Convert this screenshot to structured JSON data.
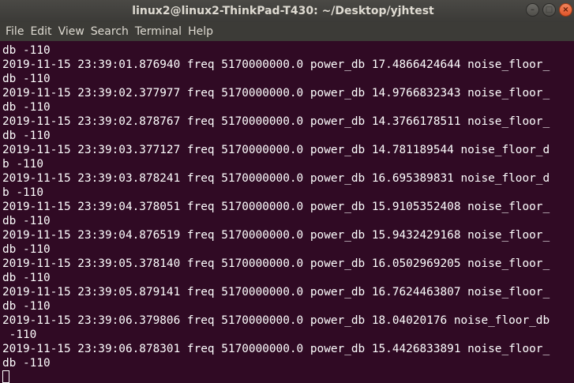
{
  "window": {
    "title": "linux2@linux2-ThinkPad-T430: ~/Desktop/yjhtest",
    "controls": {
      "minimize_glyph": "–",
      "maximize_glyph": "□",
      "close_glyph": "×"
    }
  },
  "menubar": {
    "items": [
      "File",
      "Edit",
      "View",
      "Search",
      "Terminal",
      "Help"
    ]
  },
  "terminal": {
    "lines": [
      "db -110",
      "2019-11-15 23:39:01.876940 freq 5170000000.0 power_db 17.4866424644 noise_floor_",
      "db -110",
      "2019-11-15 23:39:02.377977 freq 5170000000.0 power_db 14.9766832343 noise_floor_",
      "db -110",
      "2019-11-15 23:39:02.878767 freq 5170000000.0 power_db 14.3766178511 noise_floor_",
      "db -110",
      "2019-11-15 23:39:03.377127 freq 5170000000.0 power_db 14.781189544 noise_floor_d",
      "b -110",
      "2019-11-15 23:39:03.878241 freq 5170000000.0 power_db 16.695389831 noise_floor_d",
      "b -110",
      "2019-11-15 23:39:04.378051 freq 5170000000.0 power_db 15.9105352408 noise_floor_",
      "db -110",
      "2019-11-15 23:39:04.876519 freq 5170000000.0 power_db 15.9432429168 noise_floor_",
      "db -110",
      "2019-11-15 23:39:05.378140 freq 5170000000.0 power_db 16.0502969205 noise_floor_",
      "db -110",
      "2019-11-15 23:39:05.879141 freq 5170000000.0 power_db 16.7624463807 noise_floor_",
      "db -110",
      "2019-11-15 23:39:06.379806 freq 5170000000.0 power_db 18.04020176 noise_floor_db",
      " -110",
      "2019-11-15 23:39:06.878301 freq 5170000000.0 power_db 15.4426833891 noise_floor_",
      "db -110"
    ]
  },
  "colors": {
    "terminal_bg": "#300a24",
    "terminal_fg": "#ffffff",
    "titlebar_bg": "#3c3b37",
    "close_button": "#e95420"
  }
}
